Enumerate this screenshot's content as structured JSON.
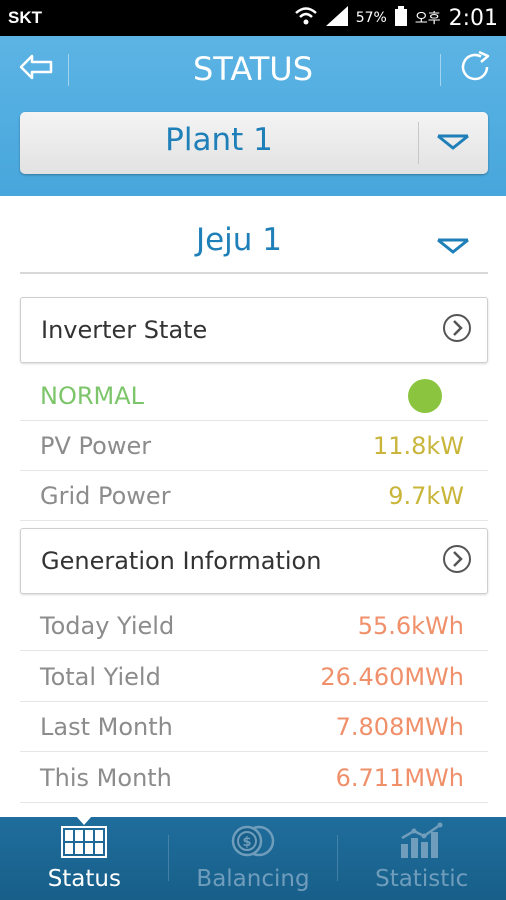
{
  "status_bar": {
    "carrier": "SKT",
    "battery": "57%",
    "notif": "오후",
    "time": "2:01"
  },
  "header": {
    "title": "STATUS",
    "back_icon": "back-arrow-icon",
    "refresh_icon": "refresh-icon",
    "plant_selected": "Plant 1"
  },
  "site": {
    "selected": "Jeju 1"
  },
  "inverter": {
    "title": "Inverter State",
    "state_label": "NORMAL",
    "state_color": "#8bc53f",
    "rows": [
      {
        "label": "PV Power",
        "value": "11.8kW"
      },
      {
        "label": "Grid Power",
        "value": "9.7kW"
      }
    ]
  },
  "generation": {
    "title": "Generation Information",
    "rows": [
      {
        "label": "Today Yield",
        "value": "55.6kWh"
      },
      {
        "label": "Total Yield",
        "value": "26.460MWh"
      },
      {
        "label": "Last Month",
        "value": "7.808MWh"
      },
      {
        "label": "This Month",
        "value": "6.711MWh"
      }
    ]
  },
  "nav": {
    "items": [
      {
        "label": "Status",
        "icon": "solar-panel-icon",
        "active": true
      },
      {
        "label": "Balancing",
        "icon": "coins-icon",
        "active": false
      },
      {
        "label": "Statistic",
        "icon": "bar-chart-icon",
        "active": false
      }
    ]
  },
  "colors": {
    "header_bg": "#48a6dc",
    "accent_text": "#1f7fb8",
    "nav_bg": "#185f8a",
    "value_yellow": "#c8b53a",
    "value_orange": "#f0906a"
  }
}
